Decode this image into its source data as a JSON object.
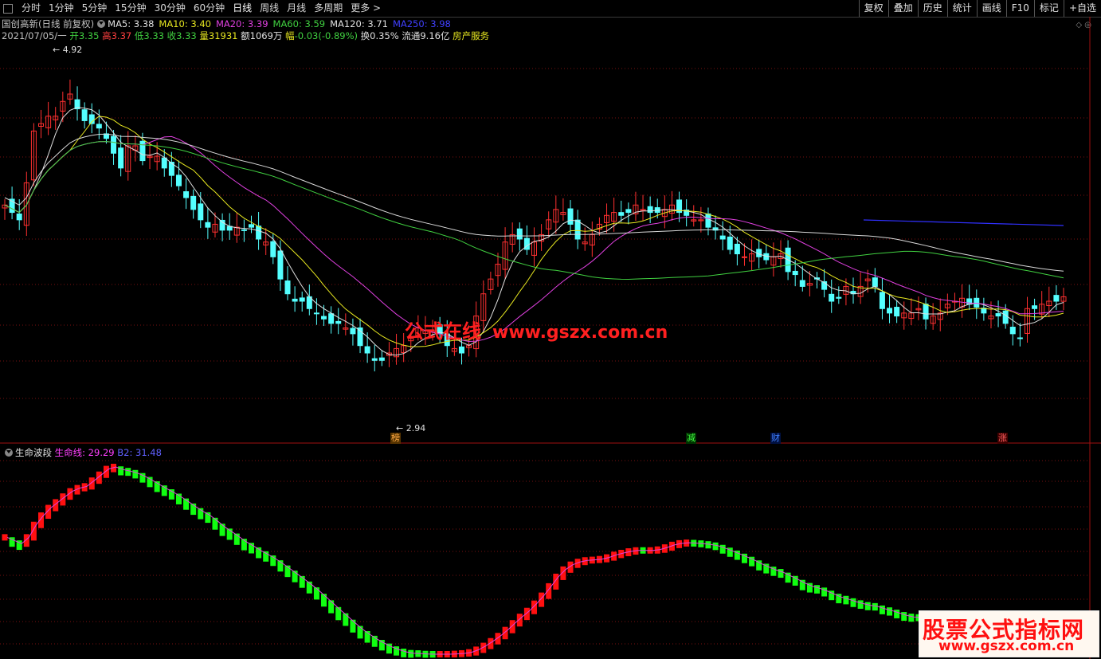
{
  "toolbar": {
    "periods": [
      "分时",
      "1分钟",
      "5分钟",
      "15分钟",
      "30分钟",
      "60分钟",
      "日线",
      "周线",
      "月线",
      "多周期",
      "更多 >"
    ],
    "active_period": "日线",
    "right_buttons": [
      "复权",
      "叠加",
      "历史",
      "统计",
      "画线",
      "F10",
      "标记",
      "+自选"
    ]
  },
  "header": {
    "stock_name": "国创高新(日线 前复权)",
    "ma": [
      {
        "label": "MA5: 3.38",
        "color": "#e0e0e0"
      },
      {
        "label": "MA10: 3.40",
        "color": "#e8e820"
      },
      {
        "label": "MA20: 3.39",
        "color": "#e040e0"
      },
      {
        "label": "MA60: 3.59",
        "color": "#40d040"
      },
      {
        "label": "MA120: 3.71",
        "color": "#e0e0e0"
      },
      {
        "label": "MA250: 3.98",
        "color": "#4040ff"
      }
    ],
    "date": "2021/07/05/一",
    "open_label": "开",
    "open": "3.35",
    "high_label": "高",
    "high": "3.37",
    "low_label": "低",
    "low": "3.33",
    "close_label": "收",
    "close": "3.33",
    "vol_label": "量",
    "vol": "31931",
    "amt_label": "额",
    "amt": "1069万",
    "chg_label": "幅",
    "chg": "-0.03(-0.89%)",
    "turnover": "换0.35%",
    "float": "流通9.16亿",
    "sector": "房产服务"
  },
  "price_annotations": {
    "high": "4.92",
    "low": "2.94"
  },
  "markers": [
    "榜",
    "减",
    "财",
    "涨"
  ],
  "indicator": {
    "name": "生命波段",
    "line1_label": "生命线: 29.29",
    "line2_label": "B2: 31.48"
  },
  "watermark": {
    "cn": "公式在线",
    "url": "www.gszx.com.cn"
  },
  "logo": {
    "line1": "股票公式指标网",
    "line2": "www.gszx.com.cn"
  },
  "colors": {
    "up": "#ff3030",
    "down": "#54ffff",
    "osc_up": "#ff1010",
    "osc_down": "#10ff10",
    "grid": "#8b1010"
  },
  "chart_data": {
    "type": "candlestick",
    "price_range": [
      2.94,
      4.92
    ],
    "series": [
      {
        "name": "MA5",
        "color": "#e0e0e0"
      },
      {
        "name": "MA10",
        "color": "#e8e820"
      },
      {
        "name": "MA20",
        "color": "#e040e0"
      },
      {
        "name": "MA60",
        "color": "#40d040"
      },
      {
        "name": "MA120",
        "color": "#e0e0e0"
      },
      {
        "name": "MA250",
        "color": "#4040ff"
      }
    ],
    "indicator_series": [
      {
        "name": "生命线",
        "last": 29.29
      },
      {
        "name": "B2",
        "last": 31.48
      }
    ],
    "close_approx": [
      3.95,
      3.9,
      3.85,
      4.1,
      4.45,
      4.5,
      4.55,
      4.55,
      4.65,
      4.7,
      4.6,
      4.52,
      4.5,
      4.47,
      4.4,
      4.3,
      4.2,
      4.35,
      4.35,
      4.25,
      4.28,
      4.28,
      4.2,
      4.15,
      4.08,
      4.0,
      3.92,
      3.85,
      3.8,
      3.82,
      3.78,
      3.78,
      3.8,
      3.78,
      3.8,
      3.72,
      3.7,
      3.6,
      3.45,
      3.35,
      3.3,
      3.3,
      3.25,
      3.22,
      3.18,
      3.15,
      3.15,
      3.12,
      3.08,
      3.0,
      2.95,
      2.9,
      2.9,
      2.95,
      2.98,
      3.0,
      3.05,
      3.12,
      3.1,
      3.1,
      3.08,
      3.0,
      2.98,
      2.95,
      3.0,
      3.2,
      3.35,
      3.45,
      3.55,
      3.7,
      3.75,
      3.72,
      3.65,
      3.7,
      3.75,
      3.85,
      3.92,
      3.9,
      3.82,
      3.72,
      3.7,
      3.75,
      3.82,
      3.88,
      3.9,
      3.88,
      3.9,
      3.95,
      3.92,
      3.9,
      3.9,
      3.92,
      3.95,
      3.9,
      3.88,
      3.85,
      3.85,
      3.8,
      3.78,
      3.72,
      3.65,
      3.62,
      3.6,
      3.62,
      3.6,
      3.58,
      3.6,
      3.62,
      3.5,
      3.48,
      3.4,
      3.42,
      3.45,
      3.38,
      3.3,
      3.32,
      3.4,
      3.35,
      3.4,
      3.45,
      3.4,
      3.25,
      3.22,
      3.2,
      3.22,
      3.22,
      3.25,
      3.18,
      3.2,
      3.22,
      3.28,
      3.3,
      3.32,
      3.28,
      3.26,
      3.22,
      3.2,
      3.2,
      3.15,
      3.08,
      3.05,
      3.25,
      3.25,
      3.28,
      3.3,
      3.3,
      3.33
    ]
  }
}
